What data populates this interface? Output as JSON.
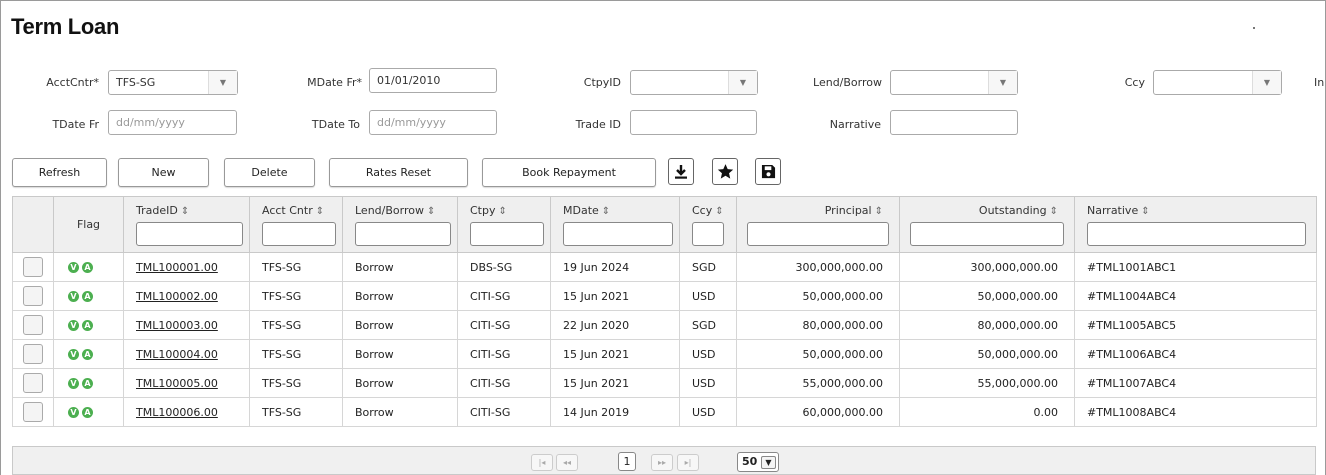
{
  "page": {
    "title": "Term Loan"
  },
  "filters": {
    "acct_cntr": {
      "label": "AcctCntr*",
      "value": "TFS-SG"
    },
    "mdate_fr": {
      "label": "MDate Fr*",
      "value": "01/01/2010"
    },
    "ctpy_id": {
      "label": "CtpyID",
      "value": ""
    },
    "lend_borrow": {
      "label": "Lend/Borrow",
      "value": ""
    },
    "ccy": {
      "label": "Ccy",
      "value": ""
    },
    "in_clipped": {
      "label": "In"
    },
    "tdate_fr": {
      "label": "TDate Fr",
      "placeholder": "dd/mm/yyyy"
    },
    "tdate_to": {
      "label": "TDate To",
      "placeholder": "dd/mm/yyyy"
    },
    "trade_id": {
      "label": "Trade ID",
      "value": ""
    },
    "narrative": {
      "label": "Narrative",
      "value": ""
    }
  },
  "toolbar": {
    "refresh": "Refresh",
    "new": "New",
    "delete": "Delete",
    "rates_reset": "Rates Reset",
    "book_repayment": "Book Repayment",
    "icons": [
      "download-icon",
      "star-icon",
      "save-icon"
    ]
  },
  "table": {
    "headers": {
      "flag": "Flag",
      "trade_id": "TradeID",
      "acct_cntr": "Acct Cntr",
      "lend_borrow": "Lend/Borrow",
      "ctpy": "Ctpy",
      "mdate": "MDate",
      "ccy": "Ccy",
      "principal": "Principal",
      "outstanding": "Outstanding",
      "narrative": "Narrative"
    },
    "sort_icon": "⇕",
    "flag_icons": {
      "v": "V",
      "a": "A"
    },
    "rows": [
      {
        "trade_id": "TML100001.00",
        "acct_cntr": "TFS-SG",
        "lend_borrow": "Borrow",
        "ctpy": "DBS-SG",
        "mdate": "19 Jun 2024",
        "ccy": "SGD",
        "principal": "300,000,000.00",
        "outstanding": "300,000,000.00",
        "narrative": "#TML1001ABC1"
      },
      {
        "trade_id": "TML100002.00",
        "acct_cntr": "TFS-SG",
        "lend_borrow": "Borrow",
        "ctpy": "CITI-SG",
        "mdate": "15 Jun 2021",
        "ccy": "USD",
        "principal": "50,000,000.00",
        "outstanding": "50,000,000.00",
        "narrative": "#TML1004ABC4"
      },
      {
        "trade_id": "TML100003.00",
        "acct_cntr": "TFS-SG",
        "lend_borrow": "Borrow",
        "ctpy": "CITI-SG",
        "mdate": "22 Jun 2020",
        "ccy": "SGD",
        "principal": "80,000,000.00",
        "outstanding": "80,000,000.00",
        "narrative": "#TML1005ABC5"
      },
      {
        "trade_id": "TML100004.00",
        "acct_cntr": "TFS-SG",
        "lend_borrow": "Borrow",
        "ctpy": "CITI-SG",
        "mdate": "15 Jun 2021",
        "ccy": "USD",
        "principal": "50,000,000.00",
        "outstanding": "50,000,000.00",
        "narrative": "#TML1006ABC4"
      },
      {
        "trade_id": "TML100005.00",
        "acct_cntr": "TFS-SG",
        "lend_borrow": "Borrow",
        "ctpy": "CITI-SG",
        "mdate": "15 Jun 2021",
        "ccy": "USD",
        "principal": "55,000,000.00",
        "outstanding": "55,000,000.00",
        "narrative": "#TML1007ABC4"
      },
      {
        "trade_id": "TML100006.00",
        "acct_cntr": "TFS-SG",
        "lend_borrow": "Borrow",
        "ctpy": "CITI-SG",
        "mdate": "14 Jun 2019",
        "ccy": "USD",
        "principal": "60,000,000.00",
        "outstanding": "0.00",
        "narrative": "#TML1008ABC4"
      }
    ]
  },
  "pager": {
    "current_page": "1",
    "page_size": "50"
  },
  "colors": {
    "flag_green": "#4caf50",
    "header_bg": "#efefef",
    "border": "#c9c9c9"
  }
}
